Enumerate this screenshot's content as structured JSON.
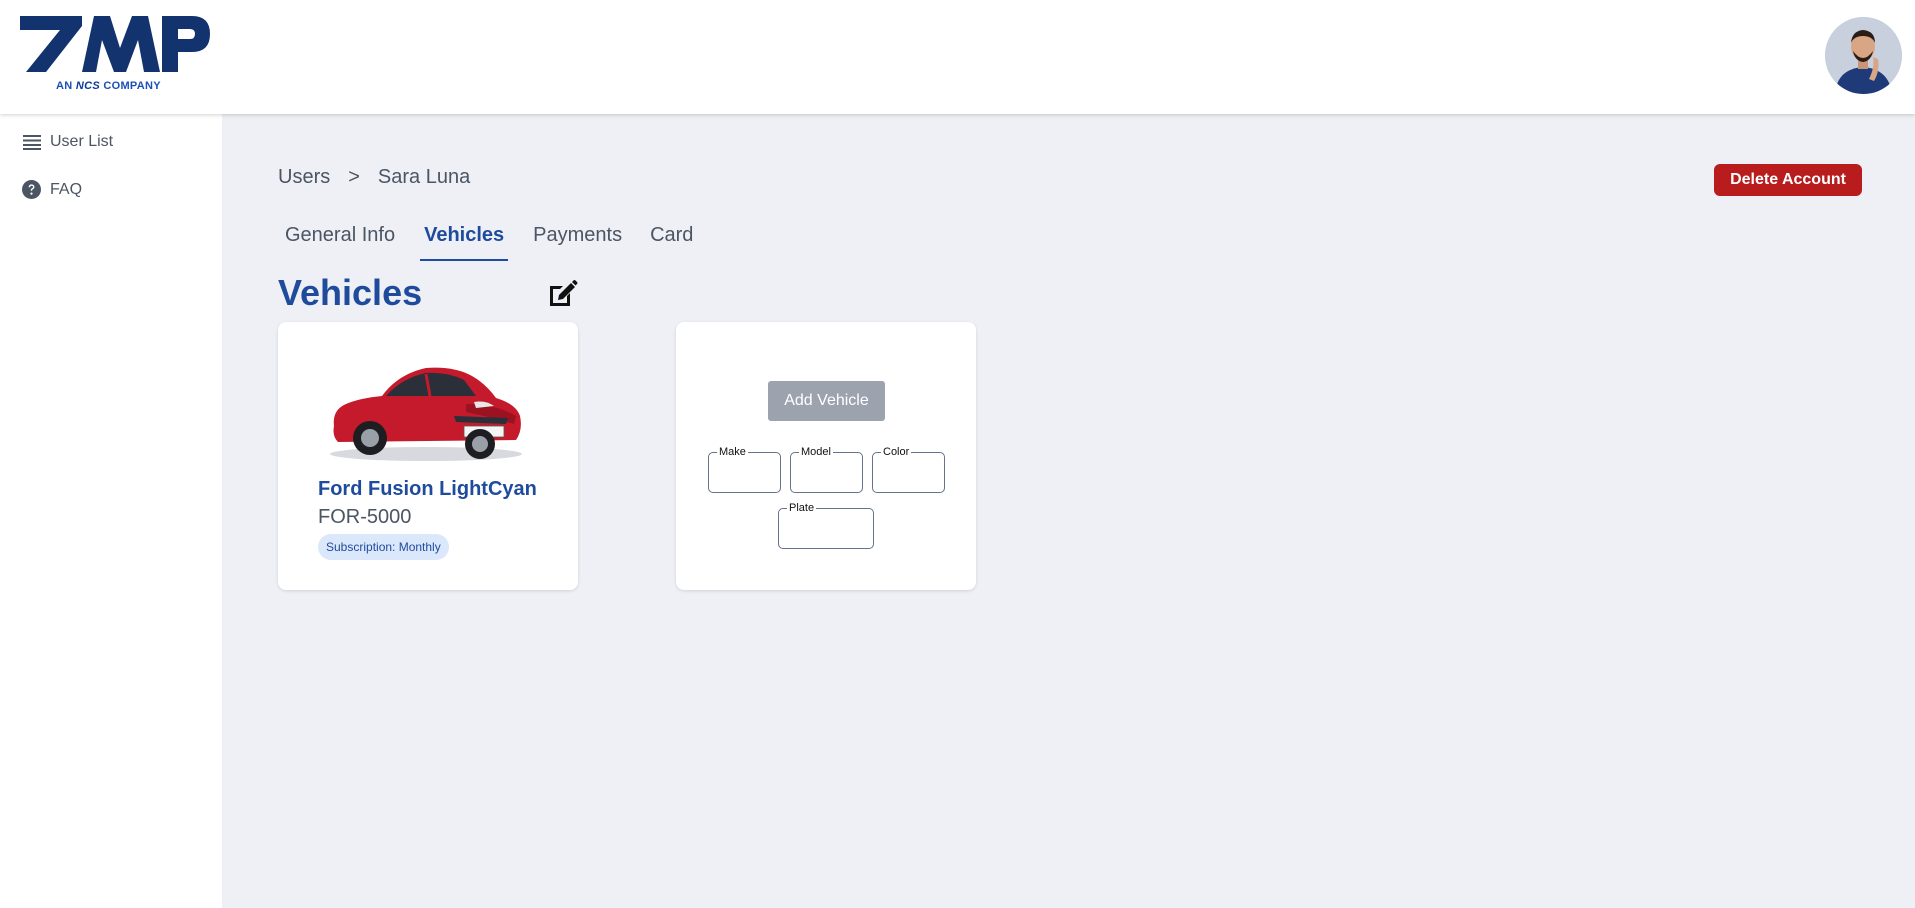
{
  "header": {
    "logo_text": "AMP",
    "logo_sub_prefix": "AN",
    "logo_sub_brand": "NCS",
    "logo_sub_suffix": "COMPANY",
    "avatar_icon": "user-avatar"
  },
  "sidebar": {
    "items": [
      {
        "label": "User List",
        "icon": "list-icon"
      },
      {
        "label": "FAQ",
        "icon": "question-circle-icon"
      }
    ]
  },
  "breadcrumb": {
    "root": "Users",
    "separator": ">",
    "current": "Sara Luna"
  },
  "actions": {
    "delete_label": "Delete Account"
  },
  "tabs": [
    {
      "label": "General Info",
      "active": false
    },
    {
      "label": "Vehicles",
      "active": true
    },
    {
      "label": "Payments",
      "active": false
    },
    {
      "label": "Card",
      "active": false
    }
  ],
  "section": {
    "title": "Vehicles"
  },
  "vehicles": [
    {
      "name": "Ford Fusion LightCyan",
      "plate": "FOR-5000",
      "subscription": "Subscription: Monthly"
    }
  ],
  "add_vehicle": {
    "button_label": "Add Vehicle",
    "fields": {
      "make": {
        "label": "Make",
        "value": ""
      },
      "model": {
        "label": "Model",
        "value": ""
      },
      "color": {
        "label": "Color",
        "value": ""
      },
      "plate": {
        "label": "Plate",
        "value": ""
      }
    }
  },
  "colors": {
    "brand_blue": "#1e4b9c",
    "danger_red": "#b81c1c",
    "background": "#eef0f5",
    "car_red": "#c41a2c"
  }
}
